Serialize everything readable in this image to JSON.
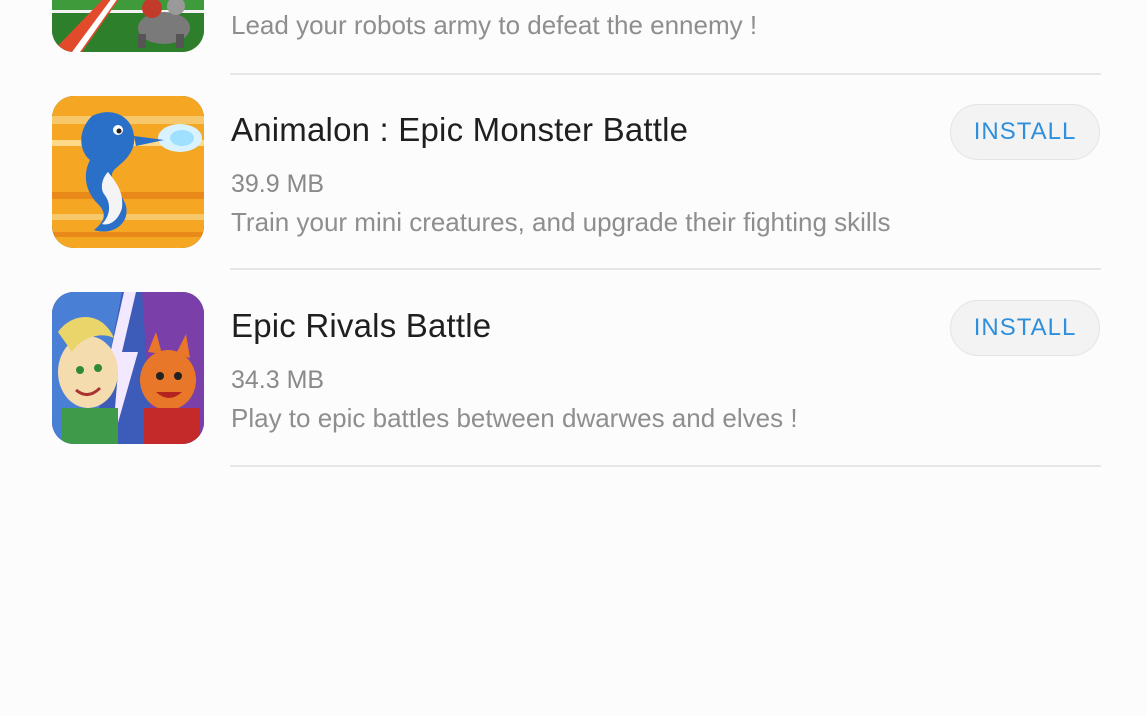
{
  "apps": [
    {
      "title": "",
      "size": "",
      "description": "Lead your robots army to defeat the ennemy !",
      "icon": "robot-game-icon"
    },
    {
      "title": "Animalon : Epic Monster Battle",
      "size": "39.9 MB",
      "description": "Train your mini creatures, and upgrade their fighting skills",
      "install_label": "INSTALL",
      "icon": "dragon-monster-icon"
    },
    {
      "title": "Epic Rivals Battle",
      "size": "34.3 MB",
      "description": "Play to epic battles between dwarwes and elves !",
      "install_label": "INSTALL",
      "icon": "elf-dwarf-icon"
    }
  ],
  "colors": {
    "accent": "#2e8fdc",
    "title_text": "#1f1f1f",
    "secondary_text": "#8a8a8a",
    "divider": "#e6e6e6",
    "background": "#fcfcfc"
  }
}
